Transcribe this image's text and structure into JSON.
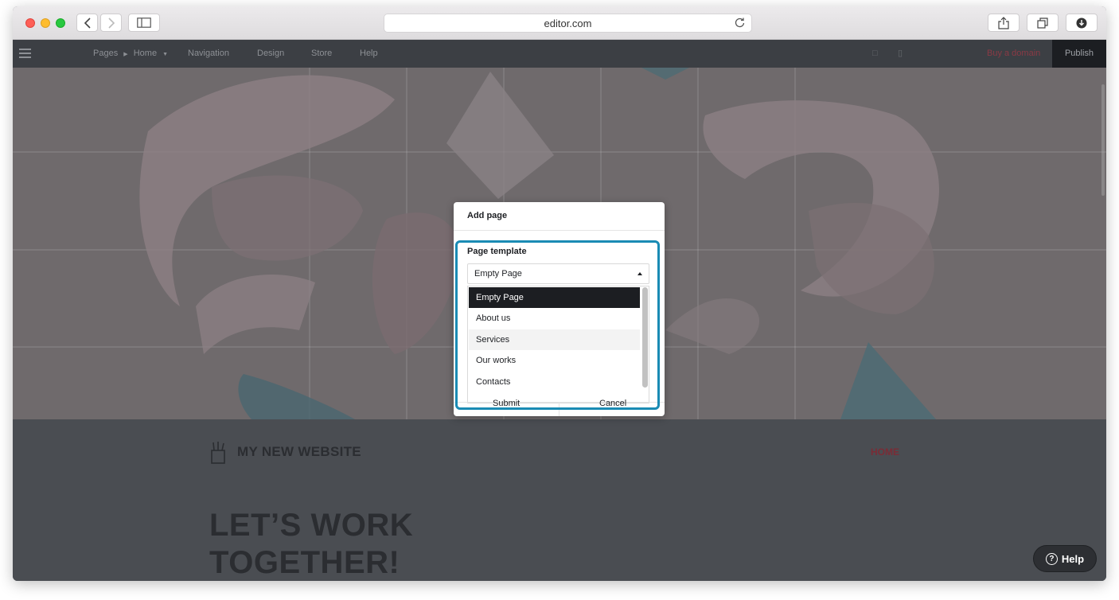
{
  "browser": {
    "url": "editor.com"
  },
  "editor_toolbar": {
    "pages_label": "Pages",
    "current_page": "Home",
    "navigation": "Navigation",
    "design": "Design",
    "store": "Store",
    "help": "Help",
    "buy_domain": "Buy a domain",
    "publish": "Publish"
  },
  "site": {
    "title": "MY NEW WEBSITE",
    "nav_home": "HOME",
    "headline_line1": "LET’S WORK",
    "headline_line2": "TOGETHER!"
  },
  "dialog": {
    "title": "Add page",
    "template_label": "Page template",
    "selected_template": "Empty Page",
    "options": [
      {
        "label": "Empty Page"
      },
      {
        "label": "About us"
      },
      {
        "label": "Services"
      },
      {
        "label": "Our works"
      },
      {
        "label": "Contacts"
      }
    ],
    "submit_label": "Submit",
    "cancel_label": "Cancel"
  },
  "help_button": {
    "label": "Help"
  },
  "colors": {
    "highlight": "#1a8bb4",
    "publish_bg": "#1c1e22",
    "selected_option_bg": "#1c1e22"
  }
}
